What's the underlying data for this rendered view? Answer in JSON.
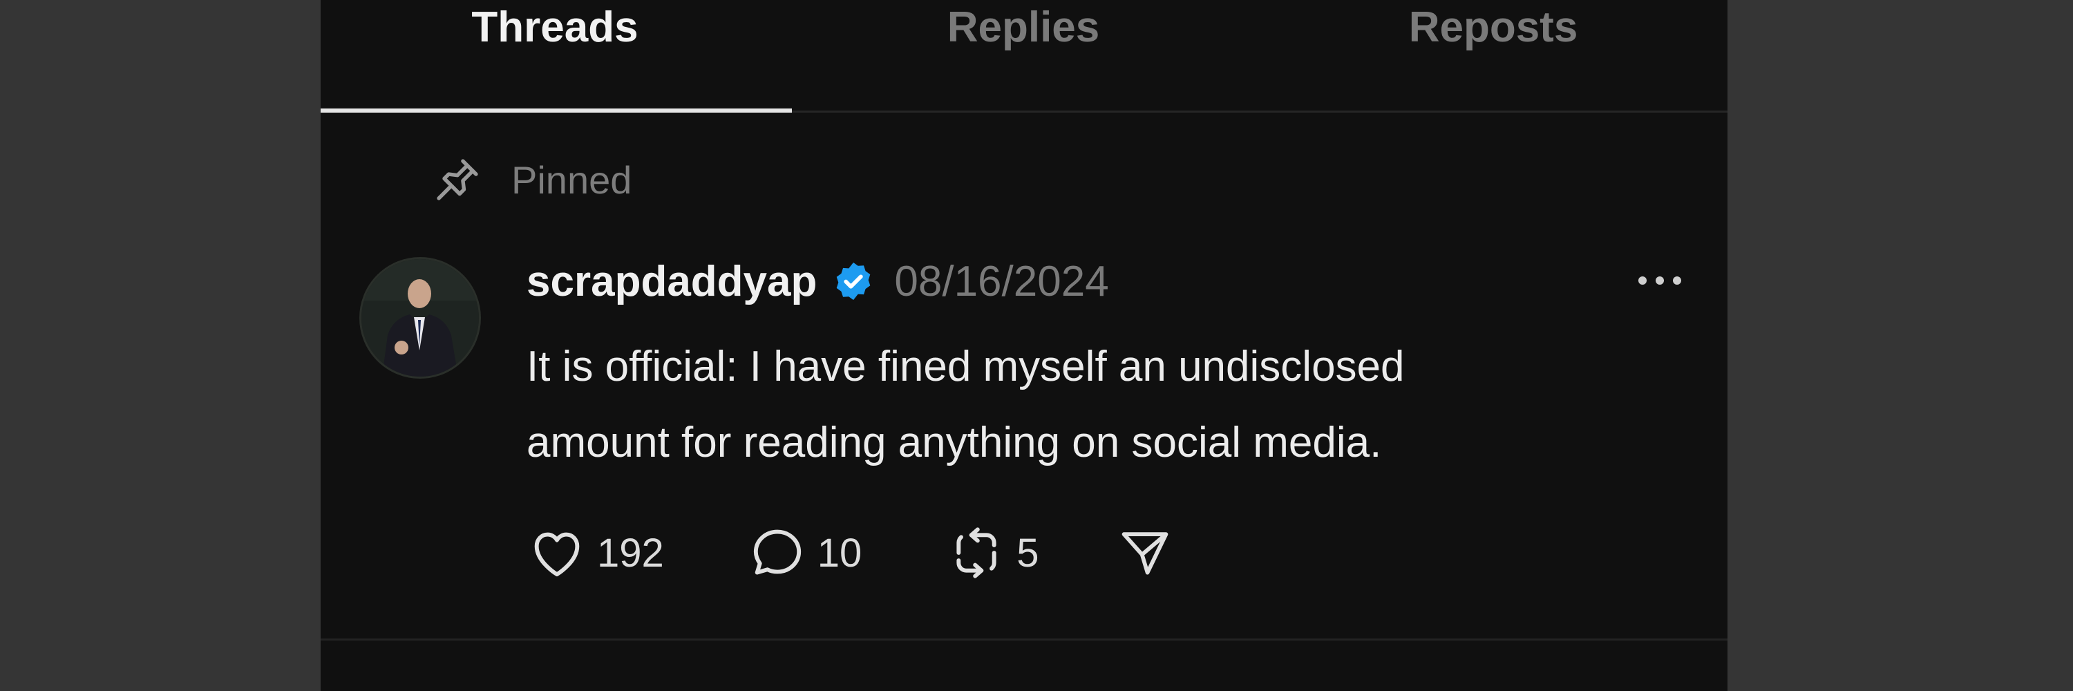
{
  "tabs": [
    {
      "label": "Threads",
      "active": true
    },
    {
      "label": "Replies",
      "active": false
    },
    {
      "label": "Reposts",
      "active": false
    }
  ],
  "pinned": {
    "icon": "pin-icon",
    "label": "Pinned"
  },
  "post": {
    "avatar": "avatar",
    "username": "scrapdaddyap",
    "verified_icon": "verified-badge-icon",
    "date": "08/16/2024",
    "more_icon": "more-options-icon",
    "body_line1": "It is official: I have fined myself an undisclosed",
    "body_line2": "amount for reading anything on social media.",
    "actions": {
      "like": {
        "icon": "heart-icon",
        "count": "192"
      },
      "reply": {
        "icon": "comment-icon",
        "count": "10"
      },
      "repost": {
        "icon": "repost-icon",
        "count": "5"
      },
      "share": {
        "icon": "send-icon"
      }
    }
  },
  "colors": {
    "background": "#101010",
    "outer": "#353535",
    "verified": "#1d9bf0",
    "muted_text": "#7a7a7a",
    "primary_text": "#f0f0f0"
  }
}
